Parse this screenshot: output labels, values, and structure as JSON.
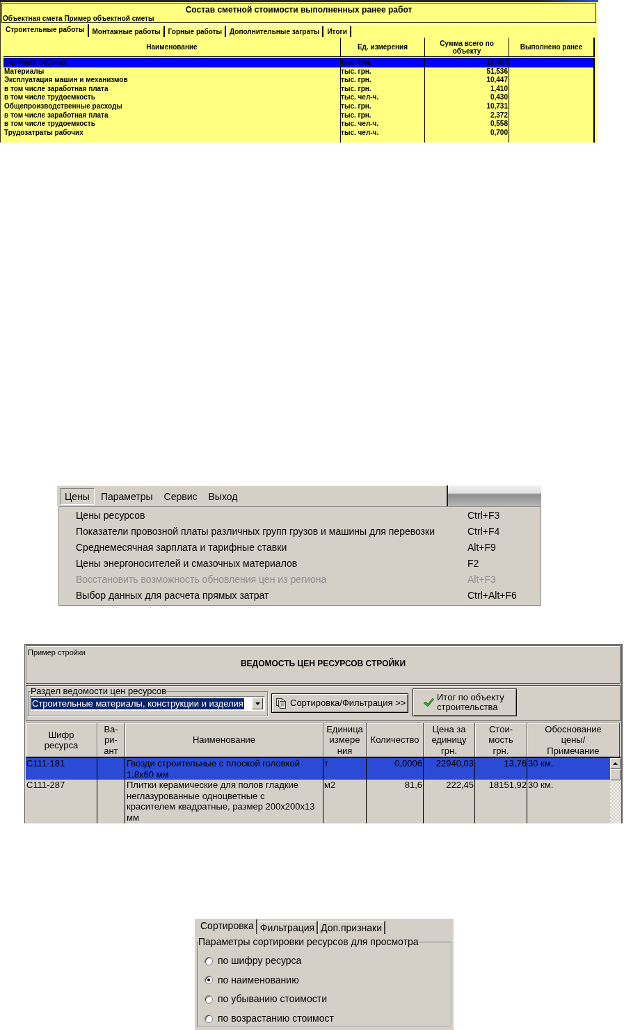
{
  "estimate": {
    "title": "Состав сметной стоимости выполненных ранее работ",
    "subtitle": "Объектная смета Пример объектной сметы",
    "tabs": [
      {
        "label": "Строительные работы",
        "selected": true
      },
      {
        "label": "Монтажные работы",
        "selected": false
      },
      {
        "label": "Горные работы",
        "selected": false
      },
      {
        "label": "Дополнительные заграты",
        "selected": false
      },
      {
        "label": "Итоги",
        "selected": false
      }
    ],
    "columns": [
      "Наименование",
      "Ед. измерения",
      "Сумма всего по объекту",
      "Выполнено ранее"
    ],
    "rows": [
      {
        "name": "Зарплата рабочих",
        "unit": "тыс. грн.",
        "total": "12,587",
        "selected": true
      },
      {
        "name": "Материалы",
        "unit": "тыс. грн.",
        "total": "51,536",
        "selected": false
      },
      {
        "name": "Эксплуатация машин и механизмов",
        "unit": "тыс. грн.",
        "total": "10,447",
        "selected": false
      },
      {
        "name": "в том числе заработная плата",
        "unit": "тыс. грн.",
        "total": "1,410",
        "selected": false
      },
      {
        "name": "в том числе трудоемкость",
        "unit": "тыс. чел-ч.",
        "total": "0,430",
        "selected": false
      },
      {
        "name": "Общепроизводственные расходы",
        "unit": "тыс. грн.",
        "total": "10,731",
        "selected": false
      },
      {
        "name": "в том числе заработная плата",
        "unit": "тыс. грн.",
        "total": "2,372",
        "selected": false
      },
      {
        "name": "в том числе трудоемкость",
        "unit": "тыс. чел-ч.",
        "total": "0,558",
        "selected": false
      },
      {
        "name": "Трудозатраты рабочих",
        "unit": "тыс. чел-ч.",
        "total": "0,700",
        "selected": false
      }
    ]
  },
  "menu": {
    "bar": [
      {
        "label": "Цены",
        "selected": true
      },
      {
        "label": "Параметры",
        "selected": false
      },
      {
        "label": "Сервис",
        "selected": false
      },
      {
        "label": "Выход",
        "selected": false
      }
    ],
    "items": [
      {
        "label": "Цены ресурсов",
        "shortcut": "Ctrl+F3",
        "disabled": false
      },
      {
        "label": "Показатели провозной платы различных групп грузов и машины для перевозки",
        "shortcut": "Ctrl+F4",
        "disabled": false
      },
      {
        "label": "Среднемесячная зарплата и тарифные ставки",
        "shortcut": "Alt+F9",
        "disabled": false
      },
      {
        "label": "Цены энергоносителей и смазочных материалов",
        "shortcut": "F2",
        "disabled": false
      },
      {
        "label": "Восстановить возможность обновления цен из региона",
        "shortcut": "Alt+F3",
        "disabled": true
      },
      {
        "label": "Выбор данных для расчета прямых затрат",
        "shortcut": "Ctrl+Alt+F6",
        "disabled": false
      }
    ]
  },
  "prices": {
    "project": "Пример стройки",
    "title": "ВЕДОМОСТЬ ЦЕН РЕСУРСОВ СТРОЙКИ",
    "section": {
      "label": "Раздел ведомости цен ресурсов",
      "value": "Строительные материалы, конструкции и изделия"
    },
    "buttons": [
      {
        "kind": "sort",
        "label": "Сортировка/Фильтрация >>"
      },
      {
        "kind": "total",
        "label": "Итог по объекту строительства"
      }
    ],
    "columns": [
      "Шифр\nресурса",
      "Ва-\nри-\nант",
      "Наименование",
      "Единица\nизмере\nния",
      "Количество",
      "Цена за\nединицу\nгрн.",
      "Стои-\nмость\nгрн.",
      "Обоснование\nцены/\nПримечание"
    ],
    "rows": [
      {
        "code": "С111-181",
        "name": "Гвозди строительные с плоской головкой\n1,8х60 мм",
        "unit": "т",
        "quantity": "0,0006",
        "price": "22940,03",
        "cost": "13,76",
        "note": "30 км.",
        "selected": true
      },
      {
        "code": "С111-287",
        "name": "Плитки керамические для полов гладкие\nнеглазурованные одноцветные с\nкрасителем квадратные, размер 200х200х13\nмм",
        "unit": "м2",
        "quantity": "81,6",
        "price": "222,45",
        "cost": "18151,92",
        "note": "30 км.",
        "selected": false
      }
    ]
  },
  "sorting": {
    "tabs": [
      {
        "label": "Сортировка",
        "selected": true
      },
      {
        "label": "Фильтрация",
        "selected": false
      },
      {
        "label": "Доп.признаки",
        "selected": false
      }
    ],
    "group_label": "Параметры сортировки ресурсов для просмотра",
    "options": [
      {
        "label": "по шифру ресурса",
        "selected": false
      },
      {
        "label": "по наименованию",
        "selected": true
      },
      {
        "label": "по убыванию стоимости",
        "selected": false
      },
      {
        "label": "по возрастанию стоимост",
        "selected": false
      }
    ]
  }
}
